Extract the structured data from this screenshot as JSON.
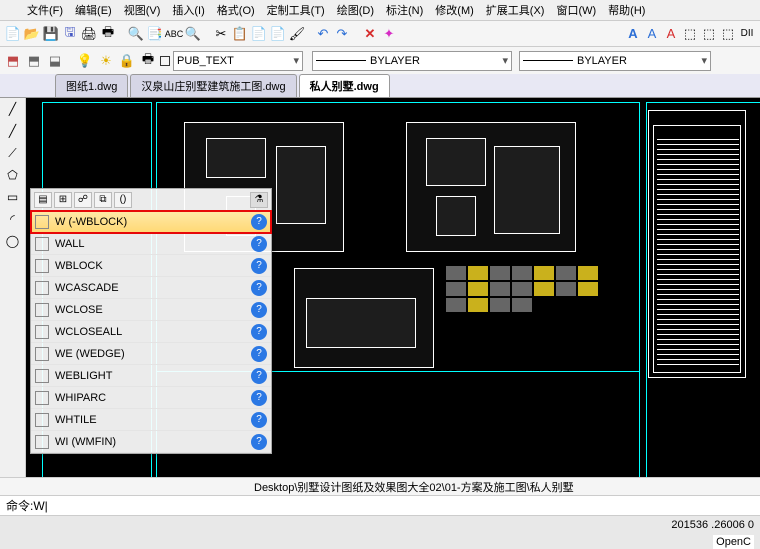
{
  "menu": [
    "文件(F)",
    "编辑(E)",
    "视图(V)",
    "插入(I)",
    "格式(O)",
    "定制工具(T)",
    "绘图(D)",
    "标注(N)",
    "修改(M)",
    "扩展工具(X)",
    "窗口(W)",
    "帮助(H)"
  ],
  "toolbar2": {
    "layer_combo": "PUB_TEXT",
    "line_combo1": "BYLAYER",
    "line_combo2": "BYLAYER",
    "right_label": "DII"
  },
  "tabs": [
    {
      "label": "图纸1.dwg",
      "active": false
    },
    {
      "label": "汉泉山庄别墅建筑施工图.dwg",
      "active": false
    },
    {
      "label": "私人别墅.dwg",
      "active": true
    }
  ],
  "suggest": {
    "items": [
      {
        "text": "W (-WBLOCK)",
        "hilite": true
      },
      {
        "text": "WALL"
      },
      {
        "text": "WBLOCK"
      },
      {
        "text": "WCASCADE"
      },
      {
        "text": "WCLOSE"
      },
      {
        "text": "WCLOSEALL"
      },
      {
        "text": "WE (WEDGE)"
      },
      {
        "text": "WEBLIGHT"
      },
      {
        "text": "WHIPARC"
      },
      {
        "text": "WHTILE"
      },
      {
        "text": "WI (WMFIN)"
      }
    ]
  },
  "pathline": "Desktop\\别墅设计图纸及效果图大全02\\01-方案及施工图\\私人别墅",
  "command": {
    "prompt": "命令: ",
    "value": "W"
  },
  "statusbar": {
    "coords": "201536 .26006 0",
    "right": "OpenC"
  },
  "chart_data": null
}
